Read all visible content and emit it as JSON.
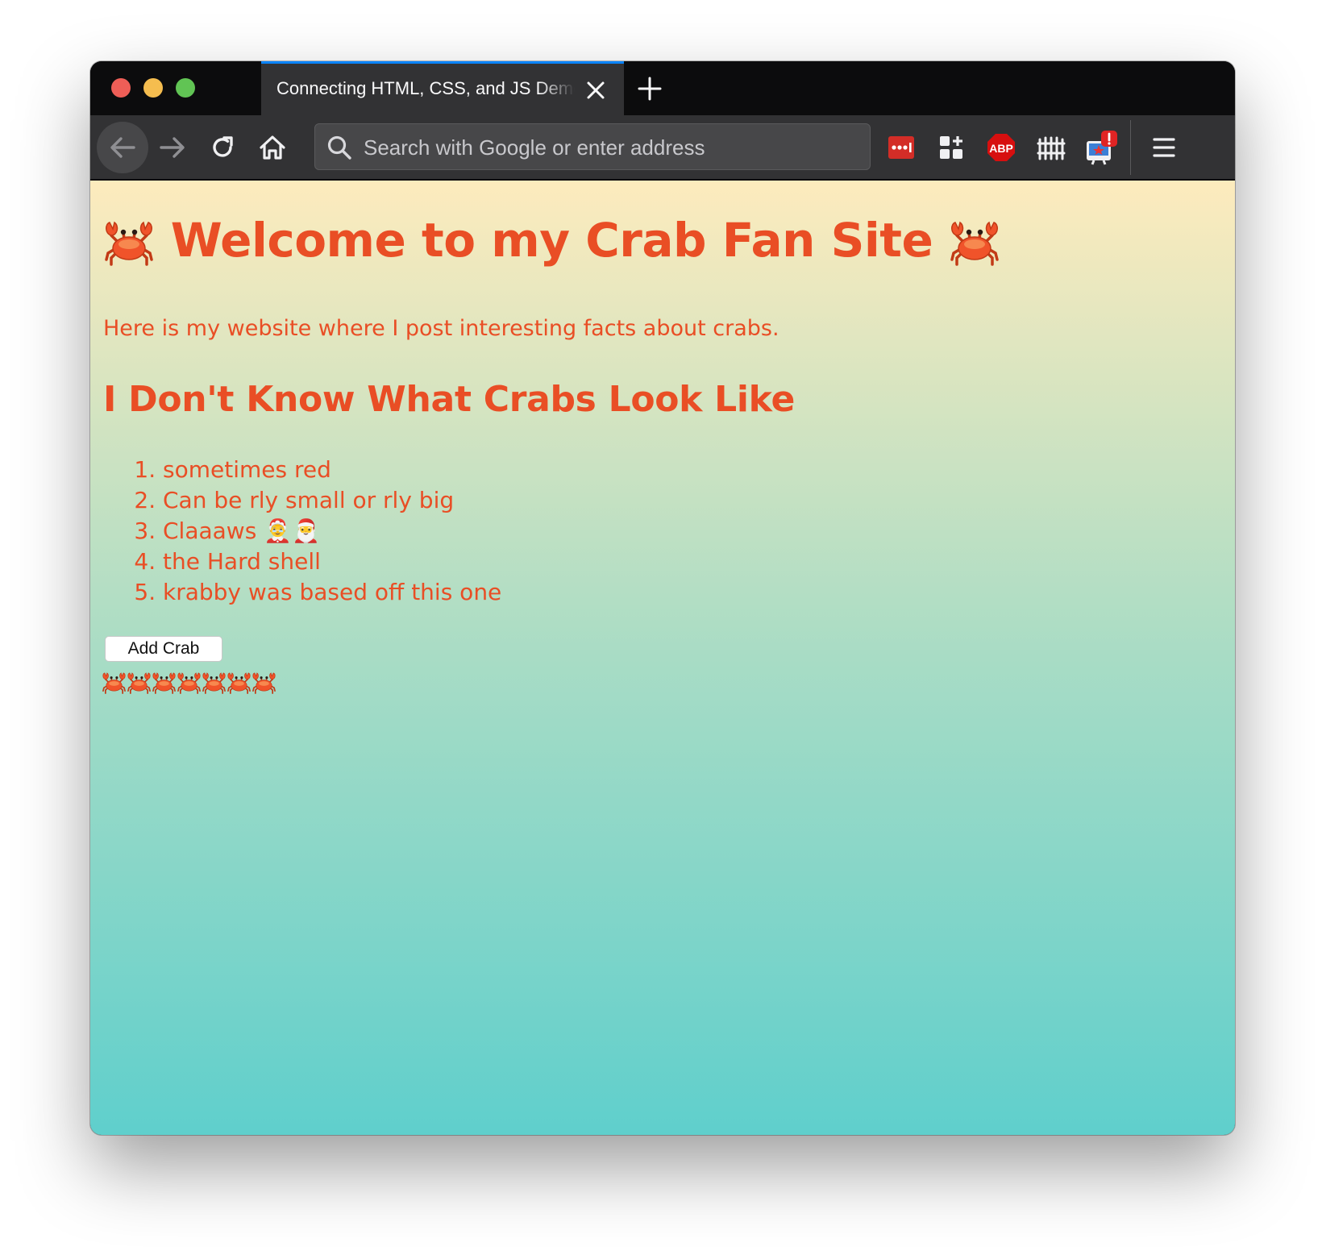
{
  "browser": {
    "tab_title": "Connecting HTML, CSS, and JS Demo",
    "address_placeholder": "Search with Google or enter address",
    "abp_label": "ABP"
  },
  "page": {
    "title": "Welcome to my Crab Fan Site",
    "intro": "Here is my website where I post interesting facts about crabs.",
    "section_title": "I Don't Know What Crabs Look Like",
    "facts": [
      "sometimes red",
      "Can be rly small or rly big",
      "Claaaws 🤶🎅",
      "the Hard shell",
      "krabby was based off this one"
    ],
    "add_button_label": "Add Crab",
    "added_crab_count": 7
  },
  "colors": {
    "text_accent": "#e94e25",
    "gradient_top": "#fdebbd",
    "gradient_bottom": "#5fcfcc",
    "tab_highlight": "#0a84ff"
  },
  "icons": [
    "back-arrow-icon",
    "forward-arrow-icon",
    "reload-icon",
    "home-icon",
    "search-icon",
    "lastpass-icon",
    "extensions-grid-icon",
    "adblock-plus-icon",
    "fence-icon",
    "notification-badge-icon",
    "hamburger-menu-icon",
    "crab-icon"
  ]
}
